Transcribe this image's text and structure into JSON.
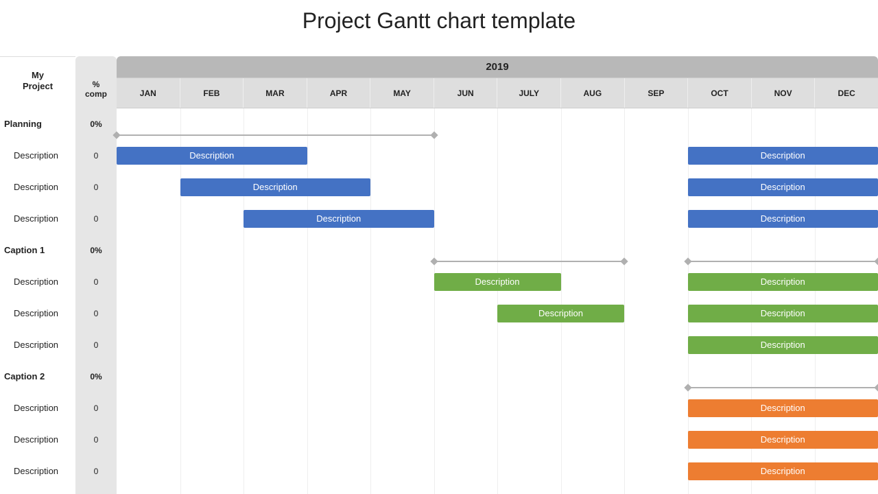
{
  "title": "Project Gantt chart template",
  "left_header": "My\nProject",
  "comp_header": "%\ncomp",
  "year": "2019",
  "months": [
    "JAN",
    "FEB",
    "MAR",
    "APR",
    "MAY",
    "JUN",
    "JULY",
    "AUG",
    "SEP",
    "OCT",
    "NOV",
    "DEC"
  ],
  "rows": [
    {
      "type": "group",
      "label": "Planning",
      "comp": "0%",
      "bracket": {
        "start": 0,
        "span": 5
      }
    },
    {
      "type": "task",
      "label": "Description",
      "comp": "0",
      "bars": [
        {
          "start": 0,
          "span": 3,
          "c": "blue",
          "t": "Description"
        },
        {
          "start": 9,
          "span": 3,
          "c": "blue",
          "t": "Description"
        }
      ]
    },
    {
      "type": "task",
      "label": "Description",
      "comp": "0",
      "bars": [
        {
          "start": 1,
          "span": 3,
          "c": "blue",
          "t": "Description"
        },
        {
          "start": 9,
          "span": 3,
          "c": "blue",
          "t": "Description"
        }
      ]
    },
    {
      "type": "task",
      "label": "Description",
      "comp": "0",
      "bars": [
        {
          "start": 2,
          "span": 3,
          "c": "blue",
          "t": "Description"
        },
        {
          "start": 9,
          "span": 3,
          "c": "blue",
          "t": "Description"
        }
      ]
    },
    {
      "type": "group",
      "label": "Caption 1",
      "comp": "0%",
      "bracket": {
        "start": 5,
        "span": 3
      },
      "bracket2": {
        "start": 9,
        "span": 3
      }
    },
    {
      "type": "task",
      "label": "Description",
      "comp": "0",
      "bars": [
        {
          "start": 5,
          "span": 2,
          "c": "green",
          "t": "Description"
        },
        {
          "start": 9,
          "span": 3,
          "c": "green",
          "t": "Description"
        }
      ]
    },
    {
      "type": "task",
      "label": "Description",
      "comp": "0",
      "bars": [
        {
          "start": 6,
          "span": 2,
          "c": "green",
          "t": "Description"
        },
        {
          "start": 9,
          "span": 3,
          "c": "green",
          "t": "Description"
        }
      ]
    },
    {
      "type": "task",
      "label": "Description",
      "comp": "0",
      "bars": [
        {
          "start": 9,
          "span": 3,
          "c": "green",
          "t": "Description"
        }
      ]
    },
    {
      "type": "group",
      "label": "Caption 2",
      "comp": "0%",
      "bracket": {
        "start": 9,
        "span": 3
      }
    },
    {
      "type": "task",
      "label": "Description",
      "comp": "0",
      "bars": [
        {
          "start": 9,
          "span": 3,
          "c": "orange",
          "t": "Description"
        }
      ]
    },
    {
      "type": "task",
      "label": "Description",
      "comp": "0",
      "bars": [
        {
          "start": 9,
          "span": 3,
          "c": "orange",
          "t": "Description"
        }
      ]
    },
    {
      "type": "task",
      "label": "Description",
      "comp": "0",
      "bars": [
        {
          "start": 9,
          "span": 3,
          "c": "orange",
          "t": "Description"
        }
      ]
    }
  ],
  "chart_data": {
    "type": "bar",
    "title": "Project Gantt chart template",
    "xlabel": "2019",
    "ylabel": "",
    "categories": [
      "JAN",
      "FEB",
      "MAR",
      "APR",
      "MAY",
      "JUN",
      "JULY",
      "AUG",
      "SEP",
      "OCT",
      "NOV",
      "DEC"
    ],
    "series": [
      {
        "name": "Planning / Description",
        "group": "Planning",
        "color": "#4472c4",
        "ranges": [
          [
            "JAN",
            "MAR"
          ],
          [
            "OCT",
            "DEC"
          ]
        ]
      },
      {
        "name": "Planning / Description",
        "group": "Planning",
        "color": "#4472c4",
        "ranges": [
          [
            "FEB",
            "APR"
          ],
          [
            "OCT",
            "DEC"
          ]
        ]
      },
      {
        "name": "Planning / Description",
        "group": "Planning",
        "color": "#4472c4",
        "ranges": [
          [
            "MAR",
            "MAY"
          ],
          [
            "OCT",
            "DEC"
          ]
        ]
      },
      {
        "name": "Caption 1 / Description",
        "group": "Caption 1",
        "color": "#70ad47",
        "ranges": [
          [
            "JUN",
            "JULY"
          ],
          [
            "OCT",
            "DEC"
          ]
        ]
      },
      {
        "name": "Caption 1 / Description",
        "group": "Caption 1",
        "color": "#70ad47",
        "ranges": [
          [
            "JULY",
            "AUG"
          ],
          [
            "OCT",
            "DEC"
          ]
        ]
      },
      {
        "name": "Caption 1 / Description",
        "group": "Caption 1",
        "color": "#70ad47",
        "ranges": [
          [
            "OCT",
            "DEC"
          ]
        ]
      },
      {
        "name": "Caption 2 / Description",
        "group": "Caption 2",
        "color": "#ed7d31",
        "ranges": [
          [
            "OCT",
            "DEC"
          ]
        ]
      },
      {
        "name": "Caption 2 / Description",
        "group": "Caption 2",
        "color": "#ed7d31",
        "ranges": [
          [
            "OCT",
            "DEC"
          ]
        ]
      },
      {
        "name": "Caption 2 / Description",
        "group": "Caption 2",
        "color": "#ed7d31",
        "ranges": [
          [
            "OCT",
            "DEC"
          ]
        ]
      }
    ],
    "groups": [
      {
        "name": "Planning",
        "comp": "0%",
        "span": [
          "JAN",
          "MAY"
        ]
      },
      {
        "name": "Caption 1",
        "comp": "0%",
        "span": [
          "JUN",
          "AUG"
        ]
      },
      {
        "name": "Caption 2",
        "comp": "0%",
        "span": [
          "OCT",
          "DEC"
        ]
      }
    ]
  }
}
